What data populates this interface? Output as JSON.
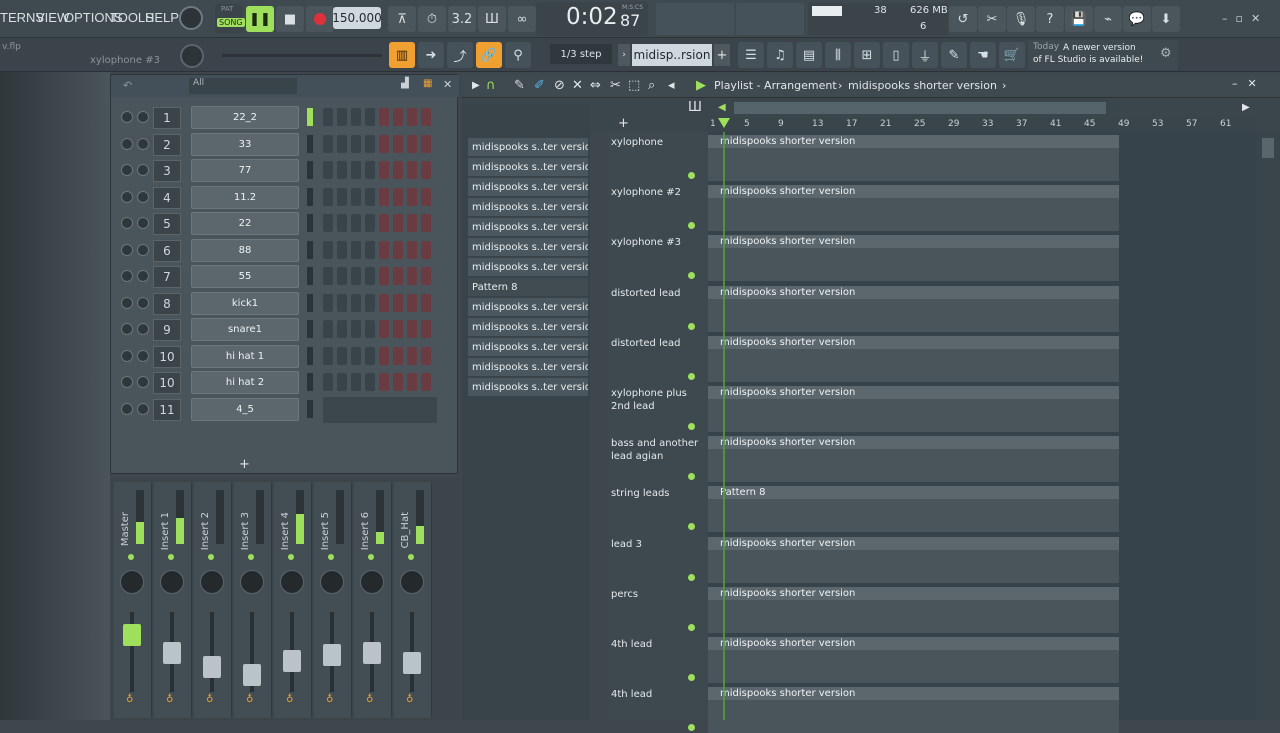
{
  "menu": {
    "patterns": "TERNS",
    "view": "VIEW",
    "options": "OPTIONS",
    "tools": "TOOLS",
    "help": "HELP"
  },
  "transport": {
    "pat": "PAT",
    "song": "SONG",
    "tempo": "150.000",
    "time": "0:02",
    "time_ms": "87",
    "time_unit": "M:S:CS"
  },
  "monitor": {
    "cpu": "38",
    "mem": "626 MB",
    "poly": "6"
  },
  "file_hint": "v.flp",
  "channel_label": "xylophone #3",
  "snap": "1/3 step",
  "pattern_selector": "midisp..rsion",
  "news": {
    "today": "Today",
    "msg": "A newer version of FL Studio is available!"
  },
  "rack": {
    "filter": "All",
    "channels": [
      {
        "num": "1",
        "name": "22_2"
      },
      {
        "num": "2",
        "name": "33"
      },
      {
        "num": "3",
        "name": "77"
      },
      {
        "num": "4",
        "name": "11.2"
      },
      {
        "num": "5",
        "name": "22"
      },
      {
        "num": "6",
        "name": "88"
      },
      {
        "num": "7",
        "name": "55"
      },
      {
        "num": "8",
        "name": "kick1"
      },
      {
        "num": "9",
        "name": "snare1"
      },
      {
        "num": "10",
        "name": "hi hat 1"
      },
      {
        "num": "10",
        "name": "hi hat 2"
      },
      {
        "num": "11",
        "name": "4_5"
      }
    ],
    "add": "+"
  },
  "mixer": {
    "strips": [
      "Master",
      "Insert 1",
      "Insert 2",
      "Insert 3",
      "Insert 4",
      "Insert 5",
      "Insert 6",
      "CB_Hat"
    ]
  },
  "picker": {
    "items": [
      "midispooks s..ter version",
      "midispooks s..ter version",
      "midispooks s..ter version",
      "midispooks s..ter version",
      "midispooks s..ter version",
      "midispooks s..ter version",
      "midispooks s..ter version",
      "Pattern 8",
      "midispooks s..ter version",
      "midispooks s..ter version",
      "midispooks s..ter version",
      "midispooks s..ter version",
      "midispooks s..ter version"
    ]
  },
  "playlist": {
    "title": "Playlist - Arrangement",
    "sep": "›",
    "song": "midispooks shorter version",
    "ruler": [
      "1",
      "5",
      "9",
      "13",
      "17",
      "21",
      "25",
      "29",
      "33",
      "37",
      "41",
      "45",
      "49",
      "53",
      "57",
      "61"
    ],
    "tracks": [
      {
        "name": "xylophone",
        "clip": "midispooks shorter version"
      },
      {
        "name": "xylophone #2",
        "clip": "midispooks shorter version"
      },
      {
        "name": "xylophone #3",
        "clip": "midispooks shorter version"
      },
      {
        "name": "distorted lead",
        "clip": "midispooks shorter version"
      },
      {
        "name": "distorted lead",
        "clip": "midispooks shorter version"
      },
      {
        "name": "xylophone plus 2nd lead",
        "clip": "midispooks shorter version"
      },
      {
        "name": "bass and another lead agian",
        "clip": "midispooks shorter version"
      },
      {
        "name": "string leads",
        "clip": "Pattern 8"
      },
      {
        "name": "lead 3",
        "clip": "midispooks shorter version"
      },
      {
        "name": "percs",
        "clip": "midispooks shorter version"
      },
      {
        "name": "4th lead",
        "clip": "midispooks shorter version"
      },
      {
        "name": "4th lead",
        "clip": "midispooks shorter version"
      }
    ]
  },
  "colors": {
    "accent": "#9ee05c",
    "clip": "#5b676d",
    "bg": "#3d474d",
    "record": "#e0303a",
    "orange": "#f0a030"
  }
}
